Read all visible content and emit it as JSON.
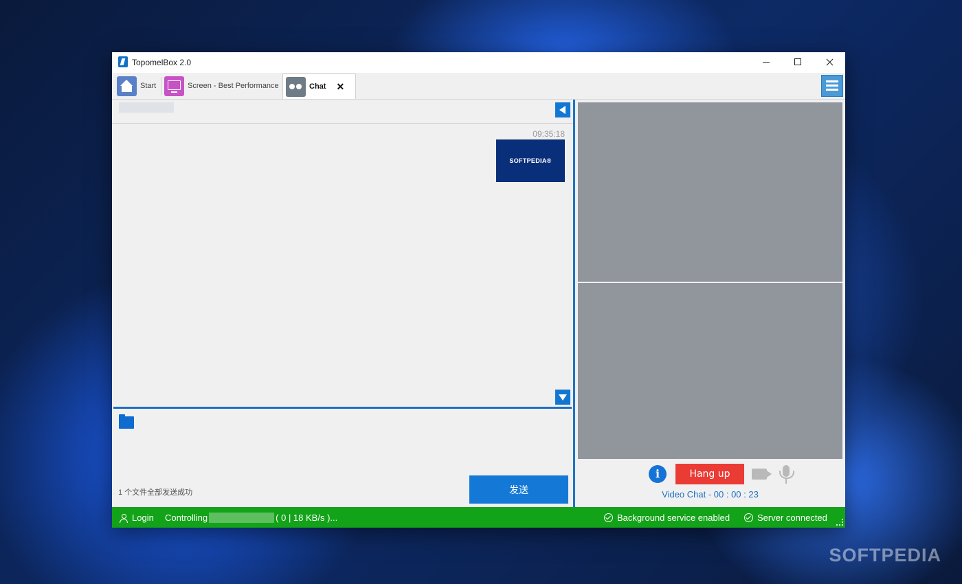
{
  "window": {
    "title": "TopomelBox 2.0"
  },
  "tabs": [
    {
      "label": "Start",
      "icon": "home-icon"
    },
    {
      "label": "Screen - Best Performance",
      "icon": "monitor-icon"
    },
    {
      "label": "Chat",
      "icon": "chat-icon",
      "active": true,
      "closable": true
    }
  ],
  "chat": {
    "messages": [
      {
        "time": "09:35:18",
        "type": "image",
        "image_text": "SOFTPEDIA®"
      }
    ],
    "file_status": "1 个文件全部发送成功",
    "send_label": "发送"
  },
  "video": {
    "hangup_label": "Hang up",
    "status_label": "Video Chat - 00 : 00 : 23",
    "info_glyph": "i"
  },
  "status_bar": {
    "login_label": "Login",
    "controlling_prefix": "Controlling",
    "controlling_suffix": "( 0 | 18 KB/s )...",
    "background_service": "Background service enabled",
    "server_status": "Server connected"
  },
  "watermark": "SOFTPEDIA",
  "colors": {
    "accent": "#1277d2",
    "status_bar": "#13a319",
    "hangup": "#ea3b34",
    "video_bg": "#91969c"
  }
}
